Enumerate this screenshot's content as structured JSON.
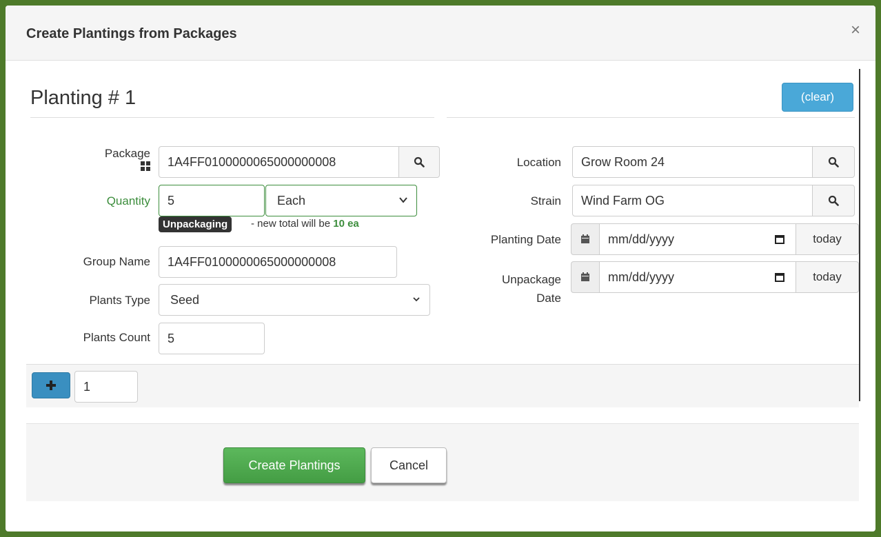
{
  "modal": {
    "title": "Create Plantings from Packages",
    "close_label": "×"
  },
  "planting": {
    "title": "Planting # 1",
    "clear_label": "(clear)"
  },
  "form": {
    "package_label": "Package",
    "package_value": "1A4FF0100000065000000008",
    "quantity_label": "Quantity",
    "quantity_value": "5",
    "quantity_unit": "Each",
    "unpackaging_badge": "Unpackaging",
    "unpackaging_note_prefix": "- new total will be",
    "unpackaging_note_value": "10 ea",
    "group_name_label": "Group Name",
    "group_name_value": "1A4FF0100000065000000008",
    "plants_type_label": "Plants Type",
    "plants_type_value": "Seed",
    "plants_count_label": "Plants Count",
    "plants_count_value": "5",
    "location_label": "Location",
    "location_value": "Grow Room 24",
    "strain_label": "Strain",
    "strain_value": "Wind Farm OG",
    "planting_date_label": "Planting Date",
    "planting_date_placeholder": "mm/dd/yyyy",
    "unpackage_date_label_line1": "Unpackage",
    "unpackage_date_label_line2": "Date",
    "unpackage_date_placeholder": "mm/dd/yyyy",
    "today_label": "today"
  },
  "adder": {
    "count_value": "1"
  },
  "footer": {
    "create_label": "Create Plantings",
    "cancel_label": "Cancel"
  },
  "colors": {
    "frame_green": "#4e7a2a",
    "accent_blue": "#4aa8d8",
    "create_green": "#5cb85c",
    "label_green": "#3c8d3c"
  }
}
